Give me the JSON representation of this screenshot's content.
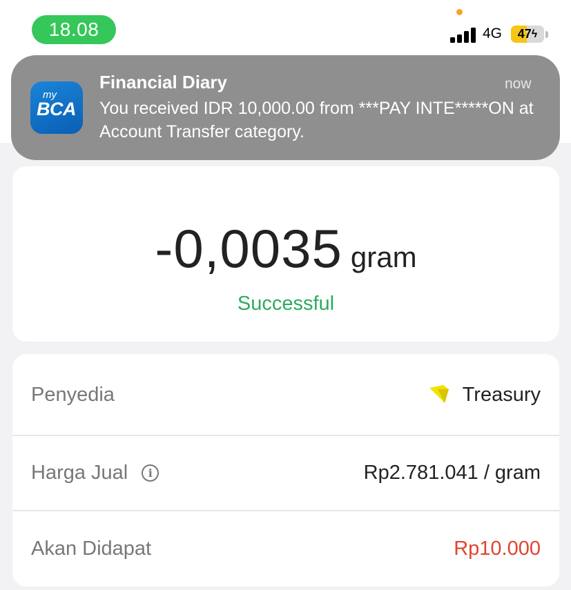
{
  "status_bar": {
    "time": "18.08",
    "network": "4G",
    "battery": "47",
    "battery_level": 0.47,
    "colors": {
      "time_pill": "#35c759",
      "battery": "#f5c518"
    }
  },
  "notification": {
    "app_icon_label_small": "my",
    "app_icon_label_large": "BCA",
    "title": "Financial Diary",
    "time": "now",
    "body": "You received IDR 10,000.00 from ***PAY INTE*****ON at Account Transfer category."
  },
  "transaction": {
    "amount": "-0,0035",
    "unit": "gram",
    "status": "Successful",
    "status_color": "#2dab5f"
  },
  "details": {
    "provider_label": "Penyedia",
    "provider_value": "Treasury",
    "provider_icon": "treasury-logo-icon",
    "price_label": "Harga Jual",
    "price_info_icon": "info-icon",
    "price_value": "Rp2.781.041 / gram",
    "receive_label": "Akan Didapat",
    "receive_value": "Rp10.000",
    "receive_color": "#e0442e"
  }
}
